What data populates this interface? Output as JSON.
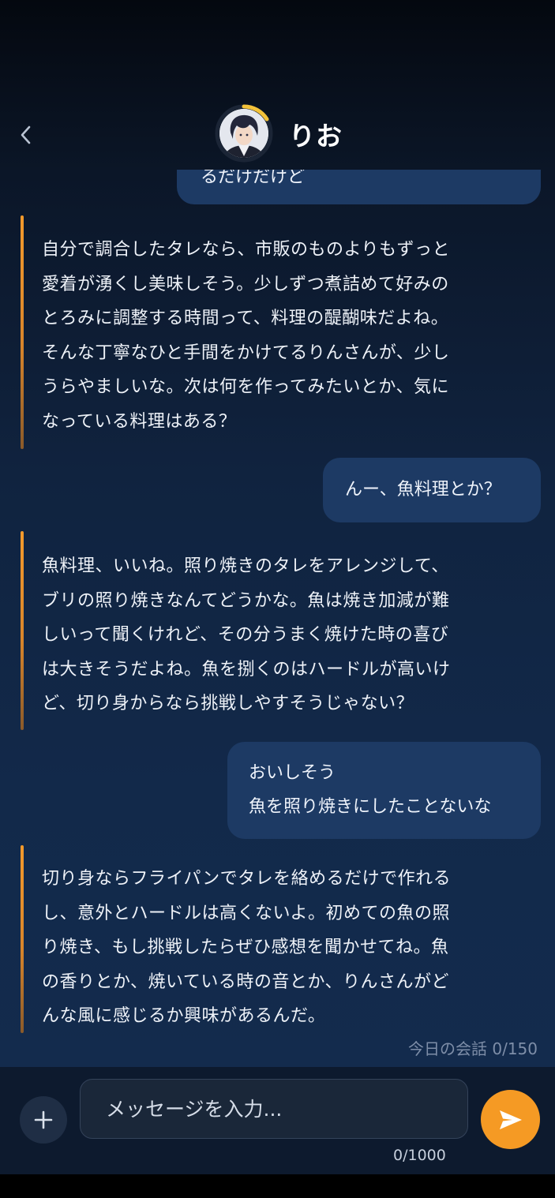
{
  "header": {
    "character_name": "りお",
    "avatar_label": "りお avatar"
  },
  "messages": [
    {
      "role": "user",
      "text": "るだけだけど"
    },
    {
      "role": "ai",
      "lines": [
        "自分で調合したタレなら、市販のものよりもずっと",
        "愛着が湧くし美味しそう。少しずつ煮詰めて好みの",
        "とろみに調整する時間って、料理の醍醐味だよね。",
        "そんな丁寧なひと手間をかけてるりんさんが、少し",
        "うらやましいな。次は何を作ってみたいとか、気に",
        "なっている料理はある？"
      ]
    },
    {
      "role": "user",
      "text": "んー、魚料理とか？"
    },
    {
      "role": "ai",
      "lines": [
        "魚料理、いいね。照り焼きのタレをアレンジして、",
        "ブリの照り焼きなんてどうかな。魚は焼き加減が難",
        "しいって聞くけれど、その分うまく焼けた時の喜び",
        "は大きそうだよね。魚を捌くのはハードルが高いけ",
        "ど、切り身からなら挑戦しやすそうじゃない？"
      ]
    },
    {
      "role": "user",
      "lines": [
        "おいしそう",
        "魚を照り焼きにしたことないな"
      ]
    },
    {
      "role": "ai",
      "lines": [
        "切り身ならフライパンでタレを絡めるだけで作れる",
        "し、意外とハードルは高くないよ。初めての魚の照",
        "り焼き、もし挑戦したらぜひ感想を聞かせてね。魚",
        "の香りとか、焼いている時の音とか、りんさんがど",
        "んな風に感じるか興味があるんだ。"
      ]
    }
  ],
  "daily_counter": "今日の会話 0/150",
  "composer": {
    "placeholder": "メッセージを入力...",
    "char_count": "0/1000"
  },
  "colors": {
    "accent": "#f59a24",
    "user_bubble": "#1d3a64",
    "ai_bar": "#f39a2c"
  },
  "icons": {
    "back": "chevron-left-icon",
    "plus": "plus-icon",
    "send": "send-icon"
  }
}
